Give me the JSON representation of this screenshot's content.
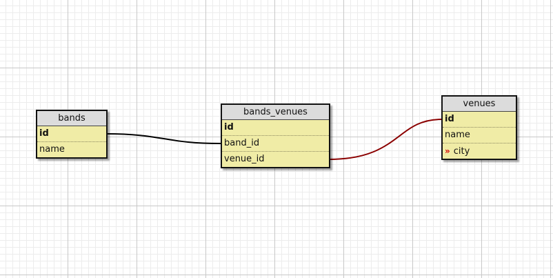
{
  "diagram": {
    "tables": [
      {
        "key": "bands",
        "title": "bands",
        "fields": [
          {
            "label": "id",
            "pk": true
          },
          {
            "label": "name"
          }
        ]
      },
      {
        "key": "bands_venues",
        "title": "bands_venues",
        "fields": [
          {
            "label": "id",
            "pk": true
          },
          {
            "label": "band_id"
          },
          {
            "label": "venue_id"
          }
        ]
      },
      {
        "key": "venues",
        "title": "venues",
        "fields": [
          {
            "label": "id",
            "pk": true
          },
          {
            "label": "name"
          },
          {
            "label": "city",
            "marker": "»"
          }
        ]
      }
    ],
    "relations": [
      {
        "from": "bands.id",
        "to": "bands_venues.band_id",
        "color": "#000000"
      },
      {
        "from": "bands_venues.venue_id",
        "to": "venues.id",
        "color": "#8b0000"
      }
    ],
    "colors": {
      "table_body": "#f0eca6",
      "table_header": "#dcdcdc",
      "marker": "#d40000"
    }
  }
}
